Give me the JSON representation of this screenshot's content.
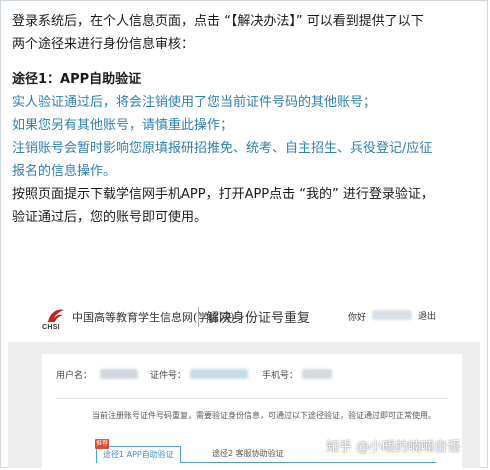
{
  "article": {
    "intro_line1": "登录系统后，在个人信息页面，点击 “【解决办法】” 可以看到提供了以下",
    "intro_line2": "两个途径来进行身份信息审核：",
    "heading": "途径1：APP自助验证",
    "blue_line1": "实人验证通过后，将会注销使用了您当前证件号码的其他账号；",
    "blue_line2": "如果您另有其他账号，请慎重此操作；",
    "blue_line3": "注销账号会暂时影响您原填报研招推免、统考、自主招生、兵役登记/应征",
    "blue_line4": "报名的信息操作。",
    "body_line1": "按照页面提示下载学信网手机APP，打开APP点击 “我的” 进行登录验证，",
    "body_line2": "验证通过后，您的账号即可使用。"
  },
  "screenshot": {
    "chsi_label": "CHSI",
    "site_name": "中国高等教育学生信息网(学信网)",
    "page_title": "解决身份证号重复",
    "greeting": "你好",
    "logout": "退出",
    "user_label": "用户名：",
    "id_label": "证件号：",
    "phone_label": "手机号：",
    "notice": "当前注册账号证件号码重复，需要验证身份信息，可通过以下途径验证，验证通过即可正常使用。",
    "tab_active": "途径1 APP自助验证",
    "tab_inactive": "途径2 客服协助验证",
    "badge": "推荐"
  },
  "watermark": "知乎 @小晤的喃喃自语",
  "colors": {
    "blue_text": "#2f7fb0",
    "logo_red": "#c8201f",
    "tab_blue": "#4aa0dd",
    "badge_red": "#e04b2c"
  }
}
